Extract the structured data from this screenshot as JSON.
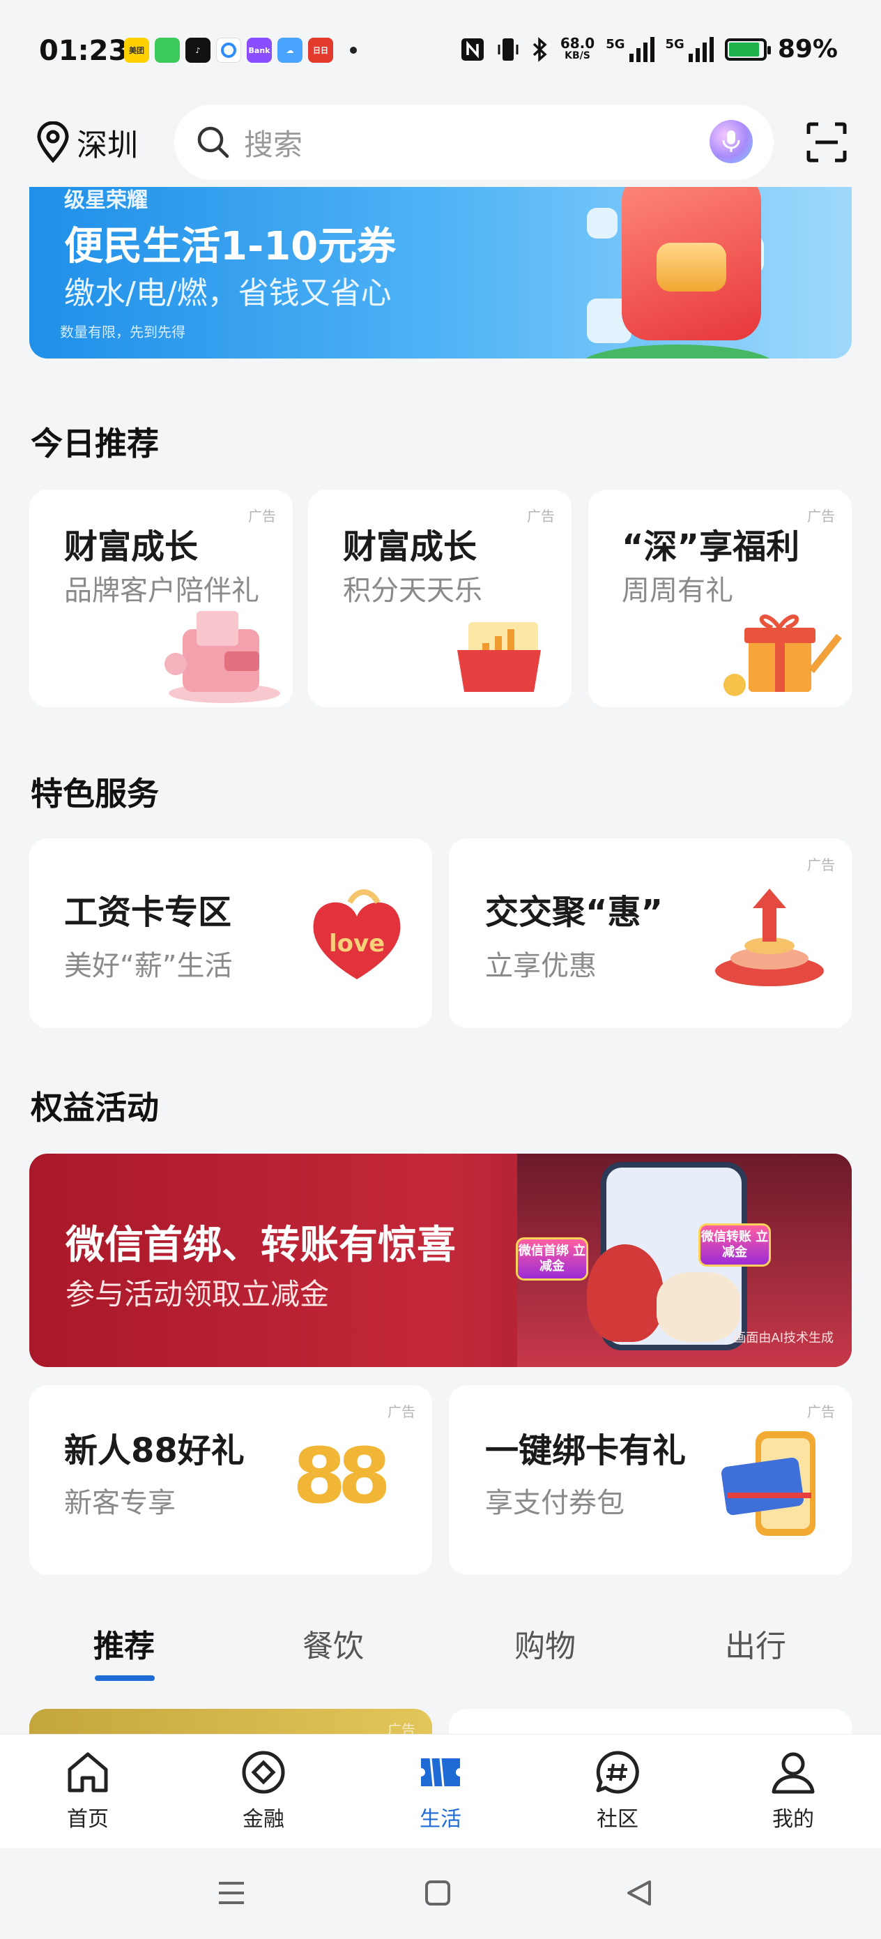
{
  "status_bar": {
    "time": "01:23",
    "apps": [
      {
        "name": "meituan-icon",
        "label": "美团",
        "color": "#ffd100"
      },
      {
        "name": "messages-icon",
        "label": "",
        "color": "#3ccb5a"
      },
      {
        "name": "tiktok-icon",
        "label": "",
        "color": "#111111"
      },
      {
        "name": "browser-icon",
        "label": "",
        "color": "#2f8cff"
      },
      {
        "name": "bank-icon",
        "label": "Bank",
        "color": "#8a4dff"
      },
      {
        "name": "weather-icon",
        "label": "",
        "color": "#4aa3ff"
      },
      {
        "name": "news-icon",
        "label": "日日",
        "color": "#e23b2e"
      }
    ],
    "net_speed_value": "68.0",
    "net_speed_unit": "KB/S",
    "sim1_label": "5G",
    "sim2_label": "5G",
    "battery": "89%",
    "battery_level": 0.89
  },
  "header": {
    "location": "深圳",
    "search_placeholder": "搜索"
  },
  "banner": {
    "top_text": "级星荣耀",
    "title": "便民生活1-10元券",
    "subtitle": "缴水/电/燃，省钱又省心",
    "note": "数量有限，先到先得"
  },
  "today": {
    "title": "今日推荐",
    "cards": [
      {
        "title": "财富成长",
        "subtitle": "品牌客户陪伴礼",
        "ad": "广告"
      },
      {
        "title": "财富成长",
        "subtitle": "积分天天乐",
        "ad": "广告"
      },
      {
        "title": "“深”享福利",
        "subtitle": "周周有礼",
        "ad": "广告"
      }
    ]
  },
  "services": {
    "title": "特色服务",
    "cards": [
      {
        "title": "工资卡专区",
        "subtitle": "美好“薪”生活",
        "ad": ""
      },
      {
        "title": "交交聚“惠”",
        "subtitle": "立享优惠",
        "ad": "广告"
      }
    ]
  },
  "rights": {
    "title": "权益活动",
    "banner_title": "微信首绑、转账有惊喜",
    "banner_subtitle": "参与活动领取立减金",
    "ad": "广告",
    "ai_note": "画面由AI技术生成",
    "badge_left": "微信首绑 立减金",
    "badge_right": "微信转账 立减金",
    "cards": [
      {
        "title": "新人88好礼",
        "subtitle": "新客专享",
        "ad": "广告"
      },
      {
        "title": "一键绑卡有礼",
        "subtitle": "享支付券包",
        "ad": "广告"
      }
    ]
  },
  "tabs": [
    "推荐",
    "餐饮",
    "购物",
    "出行"
  ],
  "feed": {
    "ad": "广告"
  },
  "bottom_nav": [
    {
      "label": "首页",
      "icon": "home-icon"
    },
    {
      "label": "金融",
      "icon": "finance-icon"
    },
    {
      "label": "生活",
      "icon": "life-icon"
    },
    {
      "label": "社区",
      "icon": "community-icon"
    },
    {
      "label": "我的",
      "icon": "profile-icon"
    }
  ],
  "colors": {
    "accent": "#1f6bd6",
    "banner_blue": "#1f8fe8",
    "rights_red": "#b81f31"
  }
}
